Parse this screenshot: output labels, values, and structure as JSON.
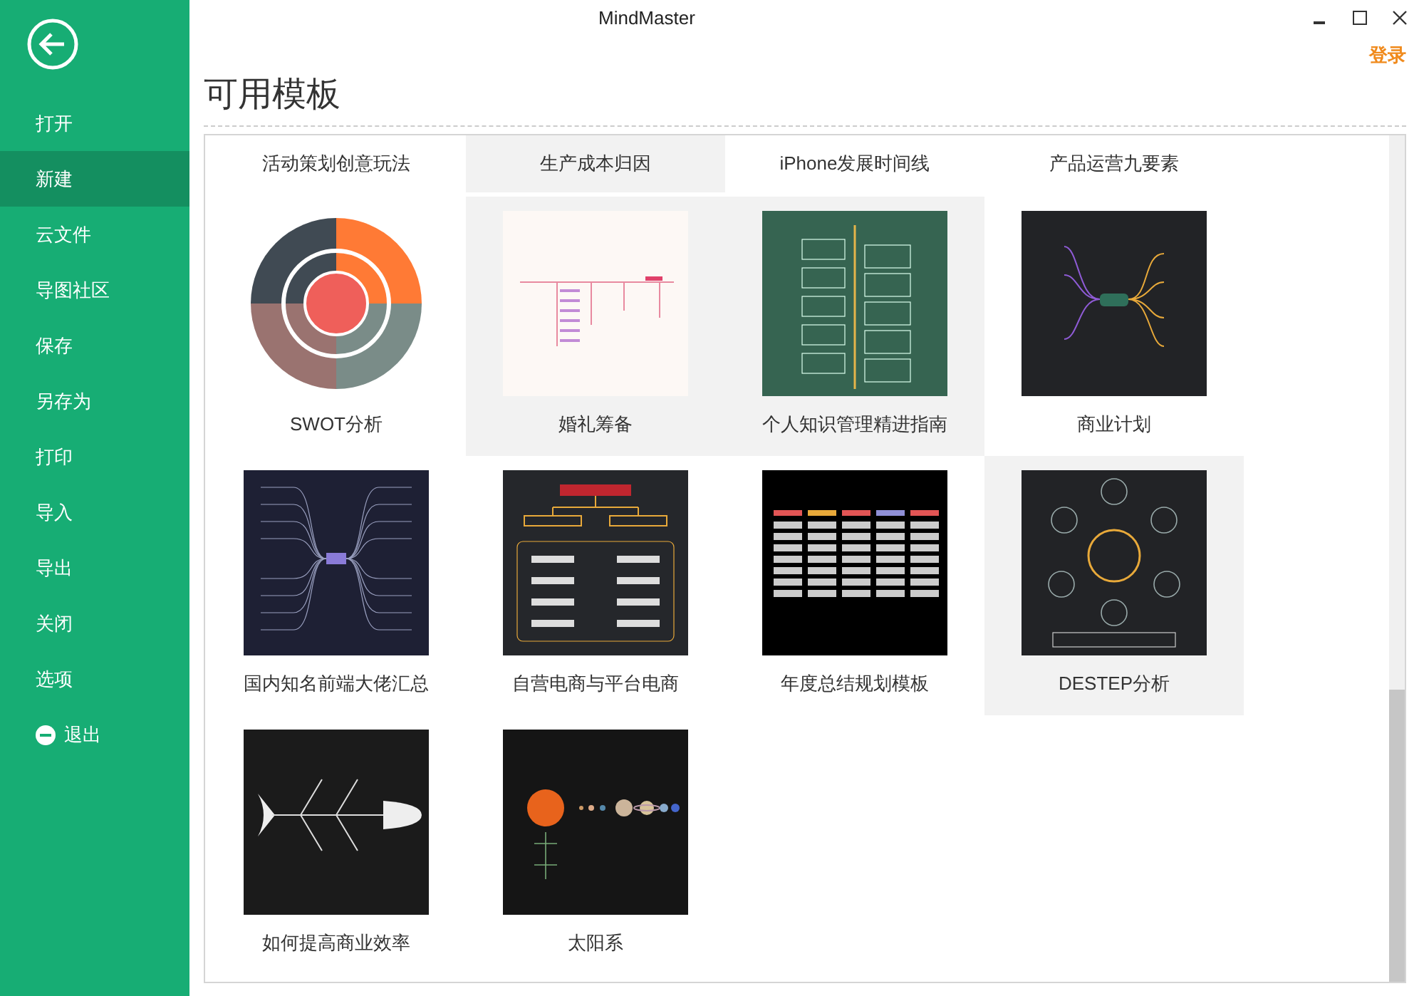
{
  "window": {
    "title": "MindMaster"
  },
  "account": {
    "login": "登录"
  },
  "sidebar": {
    "items": [
      {
        "label": "打开",
        "kind": "plain",
        "selected": false
      },
      {
        "label": "新建",
        "kind": "plain",
        "selected": true
      },
      {
        "label": "云文件",
        "kind": "plain",
        "selected": false
      },
      {
        "label": "导图社区",
        "kind": "plain",
        "selected": false
      },
      {
        "label": "保存",
        "kind": "plain",
        "selected": false
      },
      {
        "label": "另存为",
        "kind": "plain",
        "selected": false
      },
      {
        "label": "打印",
        "kind": "plain",
        "selected": false
      },
      {
        "label": "导入",
        "kind": "plain",
        "selected": false
      },
      {
        "label": "导出",
        "kind": "plain",
        "selected": false
      },
      {
        "label": "关闭",
        "kind": "plain",
        "selected": false
      },
      {
        "label": "选项",
        "kind": "plain",
        "selected": false
      },
      {
        "label": "退出",
        "kind": "exit",
        "selected": false
      }
    ]
  },
  "heading": "可用模板",
  "partial_row": [
    {
      "label": "活动策划创意玩法",
      "highlighted": false
    },
    {
      "label": "生产成本归因",
      "highlighted": true
    },
    {
      "label": "iPhone发展时间线",
      "highlighted": false
    },
    {
      "label": "产品运营九要素",
      "highlighted": false
    }
  ],
  "templates": [
    {
      "label": "SWOT分析",
      "kind": "swot",
      "highlighted": false
    },
    {
      "label": "婚礼筹备",
      "kind": "light-map",
      "highlighted": true
    },
    {
      "label": "个人知识管理精进指南",
      "kind": "green-tree",
      "highlighted": true
    },
    {
      "label": "商业计划",
      "kind": "dark-map",
      "highlighted": false
    },
    {
      "label": "国内知名前端大佬汇总",
      "kind": "navy-map",
      "highlighted": false
    },
    {
      "label": "自营电商与平台电商",
      "kind": "org-chart",
      "highlighted": false
    },
    {
      "label": "年度总结规划模板",
      "kind": "table",
      "highlighted": false
    },
    {
      "label": "DESTEP分析",
      "kind": "radial",
      "highlighted": true
    },
    {
      "label": "如何提高商业效率",
      "kind": "fishbone",
      "highlighted": false
    },
    {
      "label": "太阳系",
      "kind": "solar",
      "highlighted": false
    }
  ]
}
